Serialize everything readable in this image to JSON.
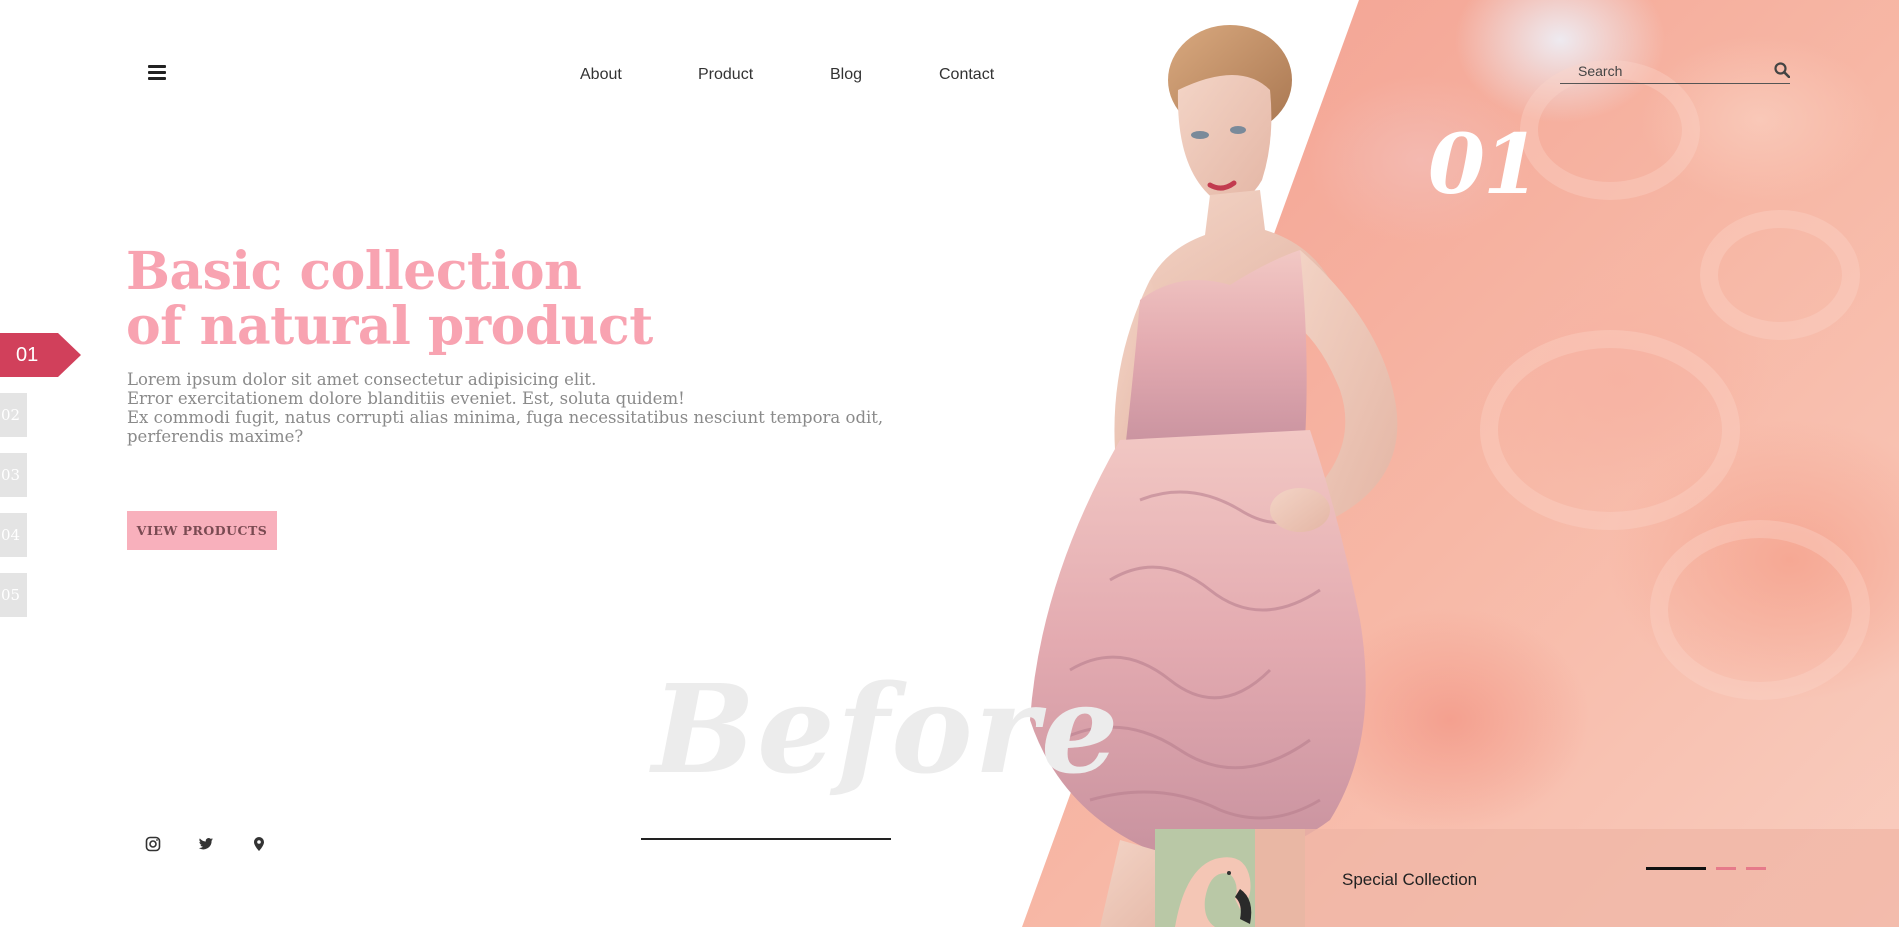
{
  "header": {
    "nav": [
      "About",
      "Product",
      "Blog",
      "Contact"
    ],
    "search_placeholder": "Search"
  },
  "hero": {
    "slide_number": "01",
    "title_line1": "Basic collection",
    "title_line2": "of natural product",
    "description": [
      "Lorem ipsum dolor sit amet consectetur adipisicing elit.",
      "Error exercitationem dolore blanditiis eveniet. Est, soluta quidem!",
      "Ex commodi fugit, natus corrupti alias minima, fuga necessitatibus nesciunt tempora odit,",
      "perferendis maxime?"
    ],
    "cta_label": "VIEW PRODUCTS",
    "watermark": "Before"
  },
  "slides": {
    "active": "01",
    "items": [
      "02",
      "03",
      "04",
      "05"
    ]
  },
  "social": [
    "instagram-icon",
    "twitter-icon",
    "location-pin-icon"
  ],
  "special": {
    "label": "Special Collection"
  },
  "colors": {
    "accent": "#d1405b",
    "title_pink": "#f8a3b1",
    "button_pink": "#f8b0bc",
    "smoke": "#f4a595"
  }
}
